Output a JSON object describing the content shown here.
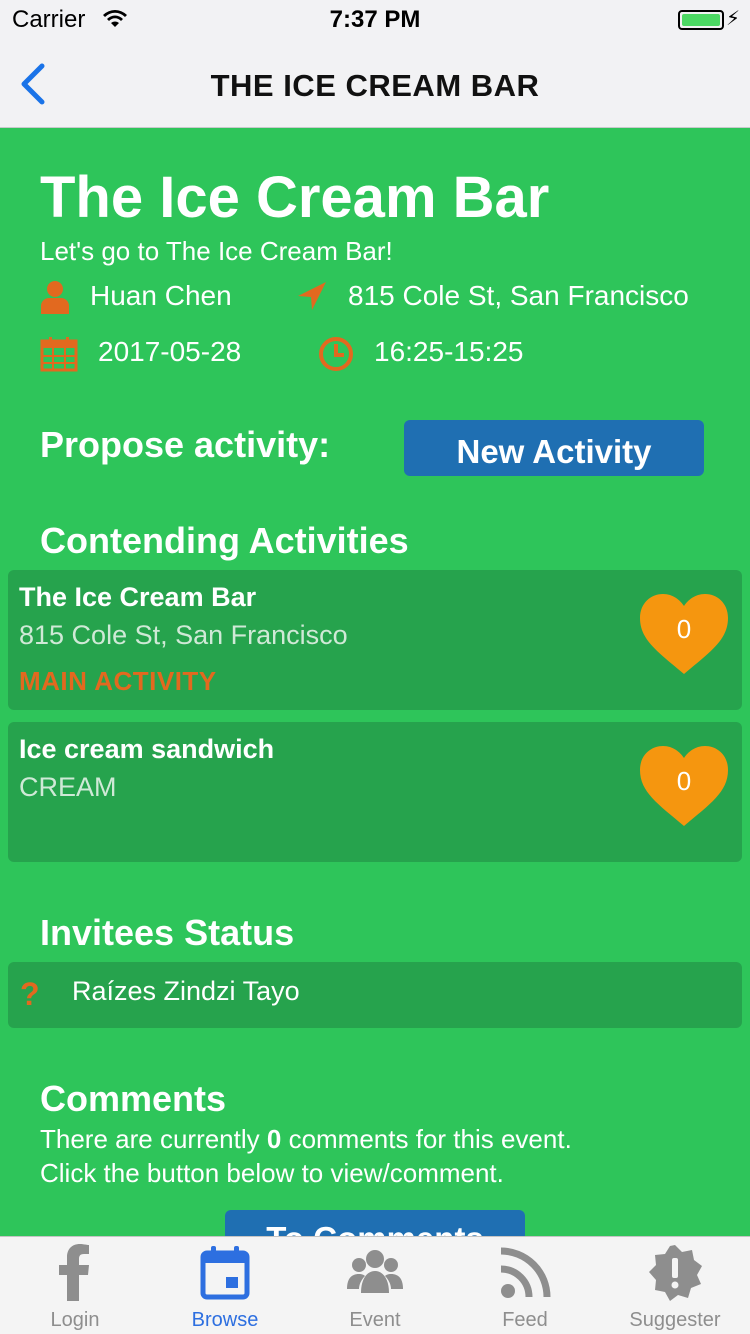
{
  "status_bar": {
    "carrier": "Carrier",
    "time": "7:37 PM"
  },
  "nav": {
    "title": "THE ICE CREAM BAR"
  },
  "event": {
    "title": "The Ice Cream Bar",
    "subtitle": "Let's go to The Ice Cream Bar!",
    "host": "Huan Chen",
    "address": "815 Cole St, San Francisco",
    "date": "2017-05-28",
    "time_range": "16:25-15:25"
  },
  "propose": {
    "label": "Propose activity:",
    "button_label": "New Activity"
  },
  "contending": {
    "heading": "Contending Activities",
    "items": [
      {
        "name": "The Ice Cream Bar",
        "detail": "815 Cole St, San Francisco",
        "tag": "MAIN ACTIVITY",
        "likes": "0"
      },
      {
        "name": "Ice cream sandwich",
        "detail": "CREAM",
        "tag": "",
        "likes": "0"
      }
    ]
  },
  "invitees": {
    "heading": "Invitees Status",
    "items": [
      {
        "status_icon": "?",
        "name": "Raízes Zindzi Tayo"
      }
    ]
  },
  "comments": {
    "heading": "Comments",
    "line1_prefix": "There are currently ",
    "count": "0",
    "line1_suffix": " comments for this event.",
    "line2": "Click the button below to view/comment.",
    "button_label": "To Comments"
  },
  "tabbar": {
    "items": [
      {
        "label": "Login",
        "icon": "facebook-icon",
        "active": false
      },
      {
        "label": "Browse",
        "icon": "calendar-icon",
        "active": true
      },
      {
        "label": "Event",
        "icon": "group-icon",
        "active": false
      },
      {
        "label": "Feed",
        "icon": "rss-icon",
        "active": false
      },
      {
        "label": "Suggester",
        "icon": "alert-badge-icon",
        "active": false
      }
    ]
  },
  "colors": {
    "background": "#2ec55a",
    "card": "#26a34d",
    "accent_orange": "#e2691f",
    "heart": "#f5960f",
    "button_blue": "#1f6fb2",
    "tab_active": "#2d6fe0"
  }
}
